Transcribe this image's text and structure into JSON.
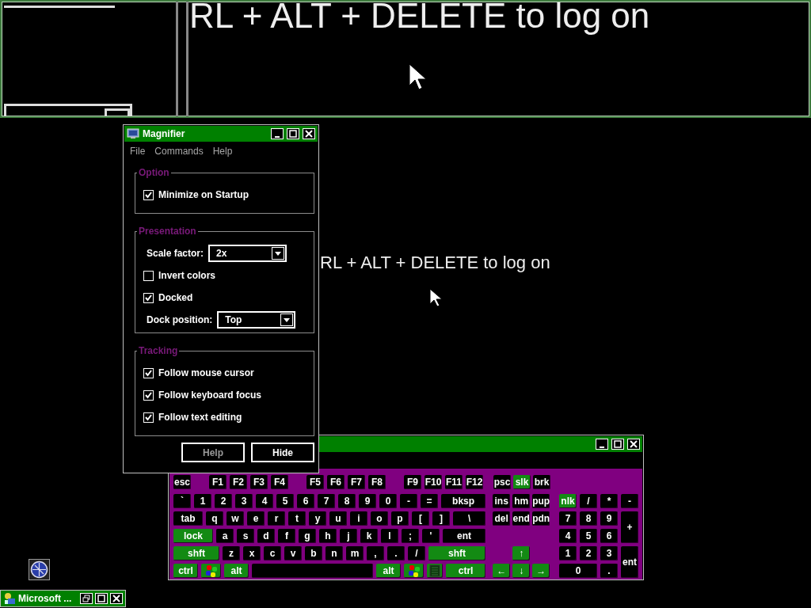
{
  "magnified_view": {
    "text": "RL + ALT + DELETE to log on"
  },
  "logon_text": "RL + ALT + DELETE to log on",
  "magnifier": {
    "title": "Magnifier",
    "menu": [
      "File",
      "Commands",
      "Help"
    ],
    "groups": [
      {
        "legend": "Option",
        "items": [
          {
            "kind": "checkbox",
            "label": "Minimize on Startup",
            "checked": true
          }
        ]
      },
      {
        "legend": "Presentation",
        "items": [
          {
            "kind": "select",
            "label": "Scale factor:",
            "value": "2x"
          },
          {
            "kind": "checkbox",
            "label": "Invert colors",
            "checked": false
          },
          {
            "kind": "checkbox",
            "label": "Docked",
            "checked": true
          },
          {
            "kind": "select",
            "label": "Dock position:",
            "value": "Top"
          }
        ]
      },
      {
        "legend": "Tracking",
        "items": [
          {
            "kind": "checkbox",
            "label": "Follow mouse cursor",
            "checked": true
          },
          {
            "kind": "checkbox",
            "label": "Follow keyboard focus",
            "checked": true
          },
          {
            "kind": "checkbox",
            "label": "Follow text editing",
            "checked": true
          }
        ]
      }
    ],
    "buttons": [
      {
        "label": "Help",
        "disabled": true
      },
      {
        "label": "Hide",
        "disabled": false
      }
    ]
  },
  "keyboard": {
    "function_keys": [
      {
        "label": "esc",
        "kind": "key"
      },
      {
        "kind": "gap"
      },
      {
        "label": "F1",
        "kind": "key"
      },
      {
        "label": "F2",
        "kind": "key"
      },
      {
        "label": "F3",
        "kind": "key"
      },
      {
        "label": "F4",
        "kind": "key"
      },
      {
        "kind": "gap"
      },
      {
        "label": "F5",
        "kind": "key"
      },
      {
        "label": "F6",
        "kind": "key"
      },
      {
        "label": "F7",
        "kind": "key"
      },
      {
        "label": "F8",
        "kind": "key"
      },
      {
        "kind": "gap"
      },
      {
        "label": "F9",
        "kind": "key"
      },
      {
        "label": "F10",
        "kind": "key"
      },
      {
        "label": "F11",
        "kind": "key"
      },
      {
        "label": "F12",
        "kind": "key"
      }
    ],
    "system_keys": [
      {
        "label": "psc",
        "kind": "key",
        "on": false
      },
      {
        "label": "slk",
        "kind": "key",
        "on": true
      },
      {
        "label": "brk",
        "kind": "key"
      }
    ],
    "main_rows": [
      [
        {
          "label": "`",
          "kind": "key"
        },
        {
          "label": "1",
          "kind": "key"
        },
        {
          "label": "2",
          "kind": "key"
        },
        {
          "label": "3",
          "kind": "key"
        },
        {
          "label": "4",
          "kind": "key"
        },
        {
          "label": "5",
          "kind": "key"
        },
        {
          "label": "6",
          "kind": "key"
        },
        {
          "label": "7",
          "kind": "key"
        },
        {
          "label": "8",
          "kind": "key"
        },
        {
          "label": "9",
          "kind": "key"
        },
        {
          "label": "0",
          "kind": "key"
        },
        {
          "label": "-",
          "kind": "key"
        },
        {
          "label": "=",
          "kind": "key"
        },
        {
          "label": "bksp",
          "kind": "key"
        }
      ],
      [
        {
          "label": "tab",
          "kind": "tab"
        },
        {
          "label": "q",
          "kind": "key"
        },
        {
          "label": "w",
          "kind": "key"
        },
        {
          "label": "e",
          "kind": "key"
        },
        {
          "label": "r",
          "kind": "key"
        },
        {
          "label": "t",
          "kind": "key"
        },
        {
          "label": "y",
          "kind": "key"
        },
        {
          "label": "u",
          "kind": "key"
        },
        {
          "label": "i",
          "kind": "key"
        },
        {
          "label": "o",
          "kind": "key"
        },
        {
          "label": "p",
          "kind": "key"
        },
        {
          "label": "[",
          "kind": "key"
        },
        {
          "label": "]",
          "kind": "key"
        },
        {
          "label": "\\",
          "kind": "key"
        }
      ],
      [
        {
          "label": "lock",
          "kind": "caps"
        },
        {
          "label": "a",
          "kind": "key"
        },
        {
          "label": "s",
          "kind": "key"
        },
        {
          "label": "d",
          "kind": "key"
        },
        {
          "label": "f",
          "kind": "key"
        },
        {
          "label": "g",
          "kind": "key"
        },
        {
          "label": "h",
          "kind": "key"
        },
        {
          "label": "j",
          "kind": "key"
        },
        {
          "label": "k",
          "kind": "key"
        },
        {
          "label": "l",
          "kind": "key"
        },
        {
          "label": ";",
          "kind": "key"
        },
        {
          "label": "'",
          "kind": "key"
        },
        {
          "label": "ent",
          "kind": "key"
        }
      ],
      [
        {
          "label": "shft",
          "kind": "shift"
        },
        {
          "label": "z",
          "kind": "key"
        },
        {
          "label": "x",
          "kind": "key"
        },
        {
          "label": "c",
          "kind": "key"
        },
        {
          "label": "v",
          "kind": "key"
        },
        {
          "label": "b",
          "kind": "key"
        },
        {
          "label": "n",
          "kind": "key"
        },
        {
          "label": "m",
          "kind": "key"
        },
        {
          "label": ",",
          "kind": "key"
        },
        {
          "label": ".",
          "kind": "key"
        },
        {
          "label": "/",
          "kind": "key"
        },
        {
          "label": "shft",
          "kind": "shift"
        }
      ],
      [
        {
          "label": "ctrl",
          "kind": "ctrl"
        },
        {
          "kind": "windows"
        },
        {
          "label": "alt",
          "kind": "alt"
        },
        {
          "kind": "space"
        },
        {
          "label": "alt",
          "kind": "alt"
        },
        {
          "kind": "windows"
        },
        {
          "kind": "menu"
        },
        {
          "label": "ctrl",
          "kind": "ctrl"
        }
      ]
    ],
    "nav_rows": [
      [
        {
          "label": "ins",
          "kind": "key"
        },
        {
          "label": "hm",
          "kind": "key"
        },
        {
          "label": "pup",
          "kind": "key"
        }
      ],
      [
        {
          "label": "del",
          "kind": "key"
        },
        {
          "label": "end",
          "kind": "key"
        },
        {
          "label": "pdn",
          "kind": "key"
        }
      ],
      [],
      [
        {
          "kind": "blank"
        },
        {
          "label": "↑",
          "kind": "arrow"
        },
        {
          "kind": "blank"
        }
      ],
      [
        {
          "label": "←",
          "kind": "arrow"
        },
        {
          "label": "↓",
          "kind": "arrow"
        },
        {
          "label": "→",
          "kind": "arrow"
        }
      ]
    ],
    "numpad": [
      {
        "label": "nlk",
        "kind": "key",
        "on": true
      },
      {
        "label": "/",
        "kind": "key"
      },
      {
        "label": "*",
        "kind": "key"
      },
      {
        "label": "-",
        "kind": "key"
      },
      {
        "label": "7",
        "kind": "key"
      },
      {
        "label": "8",
        "kind": "key"
      },
      {
        "label": "9",
        "kind": "key"
      },
      {
        "label": "+",
        "kind": "tall"
      },
      {
        "label": "4",
        "kind": "key"
      },
      {
        "label": "5",
        "kind": "key"
      },
      {
        "label": "6",
        "kind": "key"
      },
      {
        "label": "1",
        "kind": "key"
      },
      {
        "label": "2",
        "kind": "key"
      },
      {
        "label": "3",
        "kind": "key"
      },
      {
        "label": "ent",
        "kind": "tall"
      },
      {
        "label": "0",
        "kind": "wide"
      },
      {
        "label": ".",
        "kind": "key"
      }
    ]
  },
  "taskbar_button": {
    "label": "Microsoft ..."
  }
}
